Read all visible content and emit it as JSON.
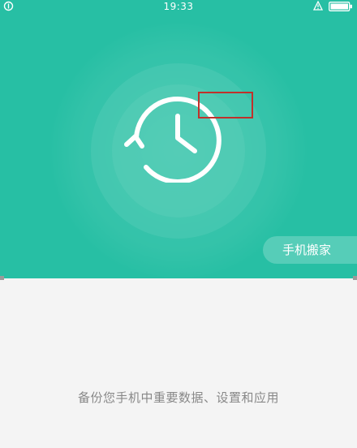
{
  "status_bar": {
    "time": "19:33"
  },
  "hero": {
    "background_color": "#27bfa4",
    "icon": "clock-history-icon",
    "migrate_button_label": "手机搬家"
  },
  "highlight": {
    "color": "#c0312b"
  },
  "content": {
    "description": "备份您手机中重要数据、设置和应用"
  }
}
